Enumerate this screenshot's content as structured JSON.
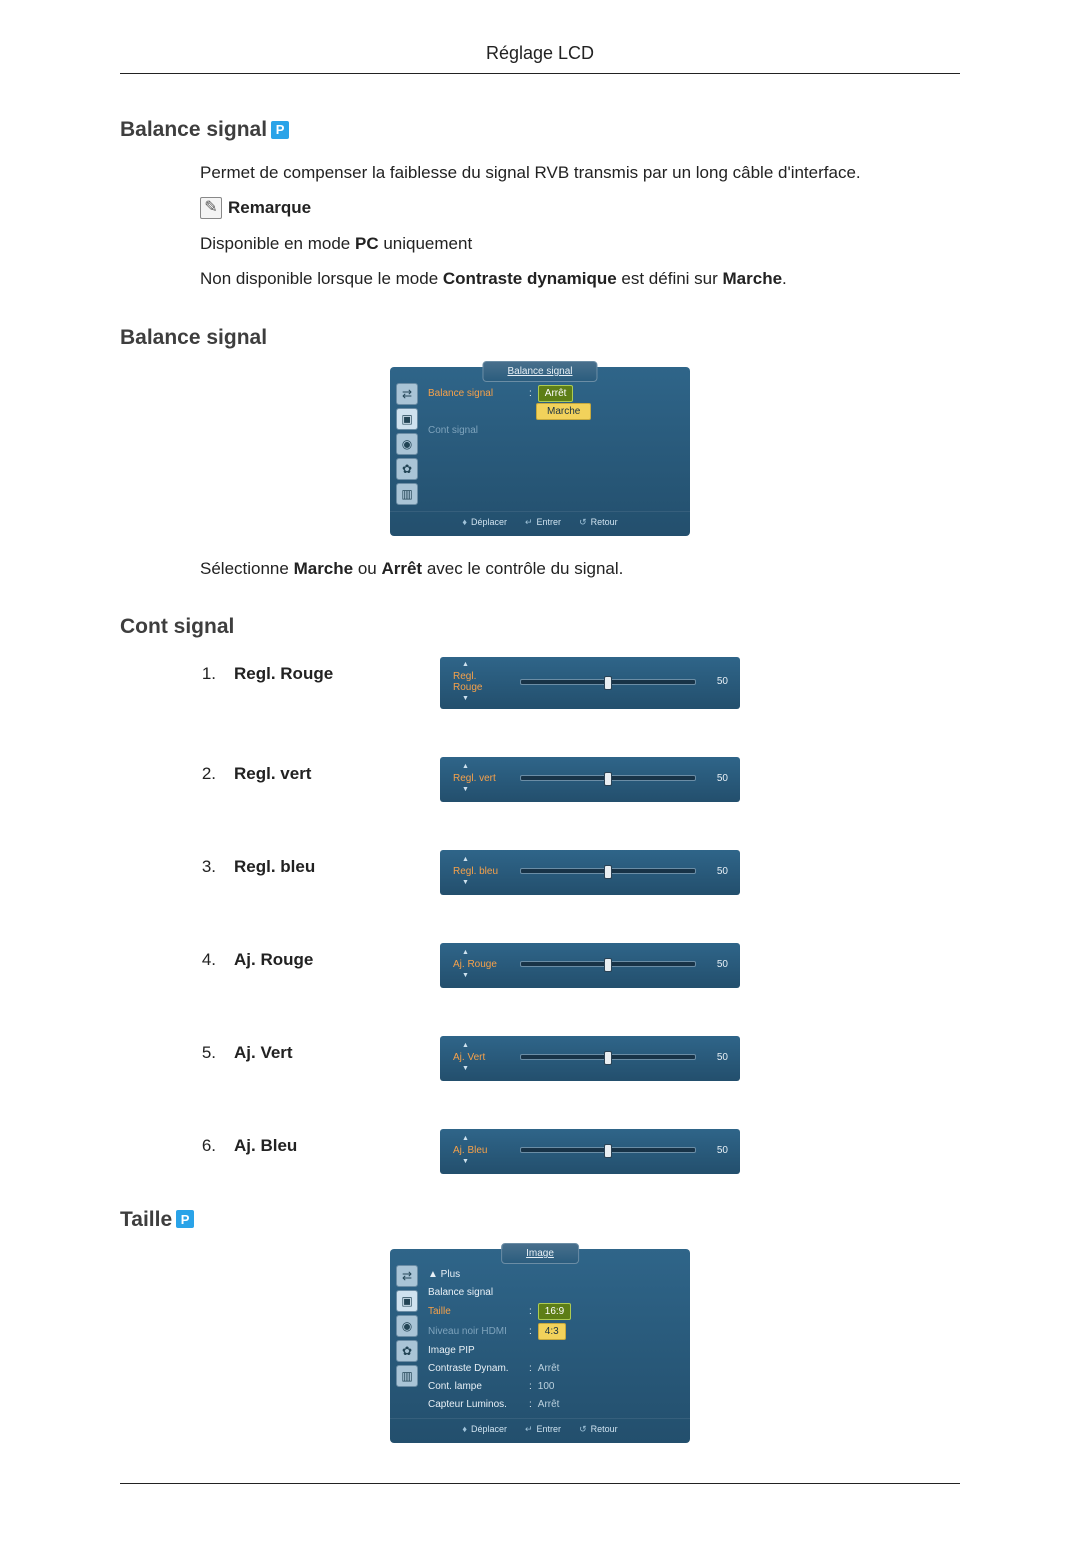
{
  "header": {
    "title": "Réglage LCD"
  },
  "icons": {
    "p_badge": "P",
    "note": "✎"
  },
  "section1": {
    "title": "Balance signal",
    "intro": "Permet de compenser la faiblesse du signal RVB transmis par un long câble d'interface.",
    "note_label": "Remarque",
    "note1_pre": "Disponible en mode ",
    "note1_bold": "PC",
    "note1_post": " uniquement",
    "note2_pre": "Non disponible lorsque le mode ",
    "note2_bold": "Contraste dynamique",
    "note2_mid": " est défini sur ",
    "note2_bold2": "Marche",
    "note2_post": "."
  },
  "section2": {
    "title": "Balance signal",
    "osd": {
      "tab": "Balance signal",
      "rows": [
        {
          "label": "Balance signal",
          "style": "orange",
          "value": "Arrêt",
          "value_style": "box-y"
        },
        {
          "label": "Cont signal",
          "style": "dim",
          "value": "",
          "value_style": ""
        }
      ],
      "option": "Marche",
      "footer": {
        "move": "Déplacer",
        "enter": "Entrer",
        "return": "Retour"
      }
    },
    "caption_pre": "Sélectionne ",
    "caption_b1": "Marche",
    "caption_mid": " ou ",
    "caption_b2": "Arrêt",
    "caption_post": " avec le contrôle du signal."
  },
  "section3": {
    "title": "Cont signal",
    "items": [
      {
        "num": "1.",
        "label": "Regl. Rouge",
        "slider_label": "Regl. Rouge",
        "value": 50
      },
      {
        "num": "2.",
        "label": "Regl. vert",
        "slider_label": "Regl. vert",
        "value": 50
      },
      {
        "num": "3.",
        "label": "Regl. bleu",
        "slider_label": "Regl. bleu",
        "value": 50
      },
      {
        "num": "4.",
        "label": "Aj. Rouge",
        "slider_label": "Aj. Rouge",
        "value": 50
      },
      {
        "num": "5.",
        "label": "Aj. Vert",
        "slider_label": "Aj. Vert",
        "value": 50
      },
      {
        "num": "6.",
        "label": "Aj. Bleu",
        "slider_label": "Aj. Bleu",
        "value": 50
      }
    ]
  },
  "section4": {
    "title": "Taille",
    "osd": {
      "tab": "Image",
      "top_marker": "▲ Plus",
      "rows": [
        {
          "label": "Balance signal",
          "style": "",
          "value": "",
          "value_style": ""
        },
        {
          "label": "Taille",
          "style": "orange",
          "value": "16:9",
          "value_style": "box-y"
        },
        {
          "label": "Niveau noir HDMI",
          "style": "dim",
          "value": "4:3",
          "value_style": "box-h"
        },
        {
          "label": "Image PIP",
          "style": "",
          "value": "",
          "value_style": ""
        },
        {
          "label": "Contraste Dynam.",
          "style": "",
          "value": "Arrêt",
          "value_style": "dim"
        },
        {
          "label": "Cont. lampe",
          "style": "",
          "value": "100",
          "value_style": "dim"
        },
        {
          "label": "Capteur Luminos.",
          "style": "",
          "value": "Arrêt",
          "value_style": "dim"
        }
      ],
      "footer": {
        "move": "Déplacer",
        "enter": "Entrer",
        "return": "Retour"
      }
    }
  },
  "osd_footer_symbols": {
    "move": "♦",
    "enter": "↵",
    "return": "↺"
  }
}
